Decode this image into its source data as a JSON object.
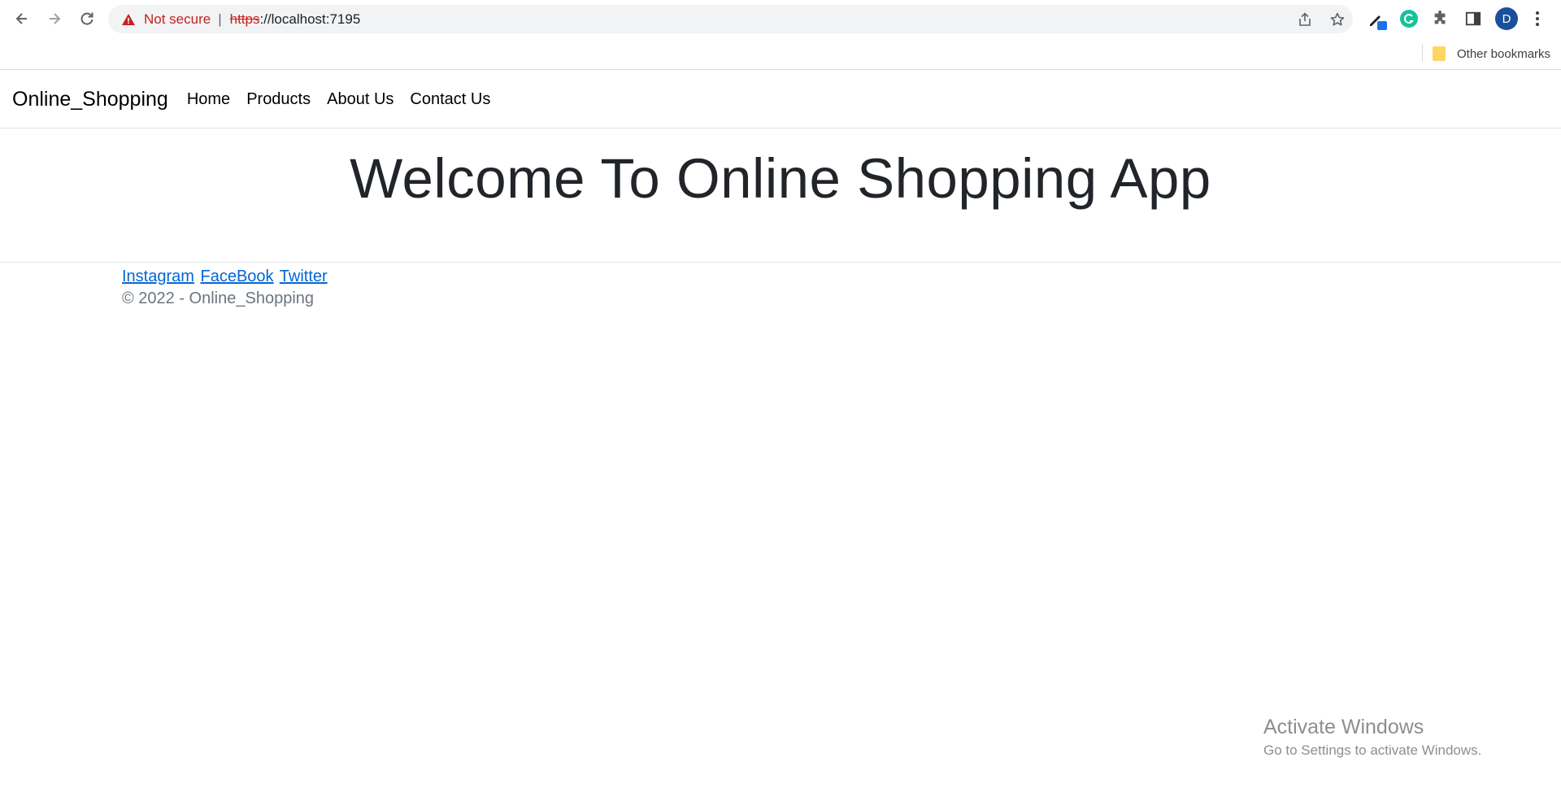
{
  "browser": {
    "address": {
      "security_label": "Not secure",
      "separator": "|",
      "url_scheme": "https",
      "url_rest": "://localhost:7195"
    },
    "profile_initial": "D",
    "bookmarks": {
      "other_label": "Other bookmarks"
    },
    "icons": [
      "back-icon",
      "forward-icon",
      "reload-icon",
      "warning-icon",
      "share-icon",
      "star-icon",
      "eyedropper-icon",
      "grammarly-icon",
      "puzzle-icon",
      "sidepanel-icon",
      "kebab-menu-icon",
      "folder-icon"
    ]
  },
  "site": {
    "brand": "Online_Shopping",
    "nav": [
      {
        "label": "Home"
      },
      {
        "label": "Products"
      },
      {
        "label": "About Us"
      },
      {
        "label": "Contact Us"
      }
    ],
    "hero_title": "Welcome To Online Shopping App",
    "footer": {
      "links": [
        {
          "label": "Instagram"
        },
        {
          "label": "FaceBook"
        },
        {
          "label": "Twitter"
        }
      ],
      "copyright": "© 2022 - Online_Shopping"
    }
  },
  "os_watermark": {
    "title": "Activate Windows",
    "subtitle": "Go to Settings to activate Windows."
  },
  "colors": {
    "link": "#0366d6",
    "not_secure": "#c5221f",
    "avatar": "#1a4f9c",
    "grammarly": "#15c39a"
  }
}
